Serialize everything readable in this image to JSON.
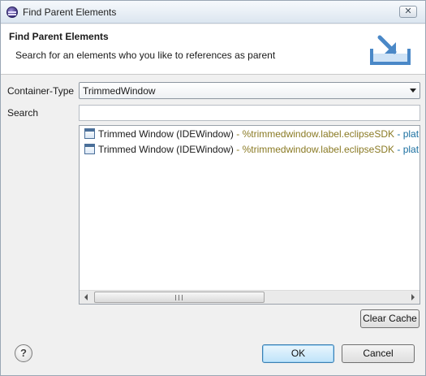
{
  "window": {
    "title": "Find Parent Elements",
    "close_symbol": "✕",
    "app_icon": "eclipse-icon"
  },
  "header": {
    "title": "Find Parent Elements",
    "description": "Search for an elements who you like to references as parent",
    "icon": "wizard-import-icon"
  },
  "form": {
    "container_type_label": "Container-Type",
    "container_type_value": "TrimmedWindow",
    "search_label": "Search",
    "search_value": "",
    "search_placeholder": ""
  },
  "results": {
    "items": [
      {
        "name": "Trimmed Window (IDEWindow)",
        "sep1": " - ",
        "label": "%trimmedwindow.label.eclipseSDK",
        "sep2": " - ",
        "plat": "plat"
      },
      {
        "name": "Trimmed Window (IDEWindow)",
        "sep1": " - ",
        "label": "%trimmedwindow.label.eclipseSDK",
        "sep2": " - ",
        "plat": "plat"
      }
    ]
  },
  "buttons": {
    "clear_cache": "Clear Cache",
    "ok": "OK",
    "cancel": "Cancel",
    "help_symbol": "?"
  },
  "colors": {
    "label_color": "#8a7a24",
    "plat_color": "#1a6fa0",
    "default_button_border": "#3c7fb1"
  }
}
